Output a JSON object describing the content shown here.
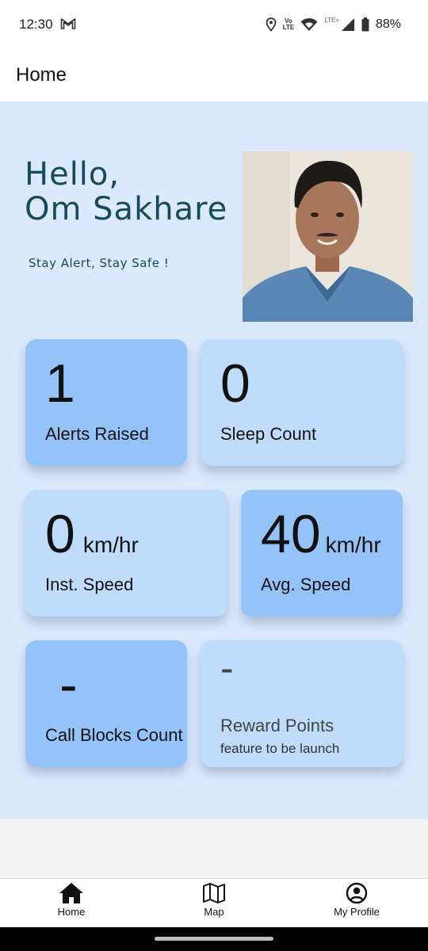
{
  "status_bar": {
    "time": "12:30",
    "battery": "88%",
    "lte_label": "LTE+",
    "volte_label": "Vo\nLTE"
  },
  "app_bar": {
    "title": "Home"
  },
  "header": {
    "greeting_line1": "Hello,",
    "greeting_line2": "Om Sakhare",
    "tagline": "Stay Alert, Stay Safe !"
  },
  "cards": {
    "alerts": {
      "value": "1",
      "label": "Alerts Raised"
    },
    "sleep": {
      "value": "0",
      "label": "Sleep Count"
    },
    "inst_speed": {
      "value": "0",
      "unit": "km/hr",
      "label": "Inst. Speed"
    },
    "avg_speed": {
      "value": "40",
      "unit": "km/hr",
      "label": "Avg. Speed"
    },
    "call_blocks": {
      "value": "-",
      "label": "Call Blocks Count"
    },
    "reward": {
      "value": "-",
      "label": "Reward Points",
      "sublabel": "feature to be launch"
    }
  },
  "bottom_nav": {
    "items": [
      {
        "label": "Home",
        "icon": "home-icon"
      },
      {
        "label": "Map",
        "icon": "map-icon"
      },
      {
        "label": "My Profile",
        "icon": "account-circle-icon"
      }
    ]
  },
  "colors": {
    "content_bg": "#dbe9fd",
    "card_dark": "#93c3f9",
    "card_light": "#bfdcfc",
    "greeting_text": "#174a5c"
  }
}
